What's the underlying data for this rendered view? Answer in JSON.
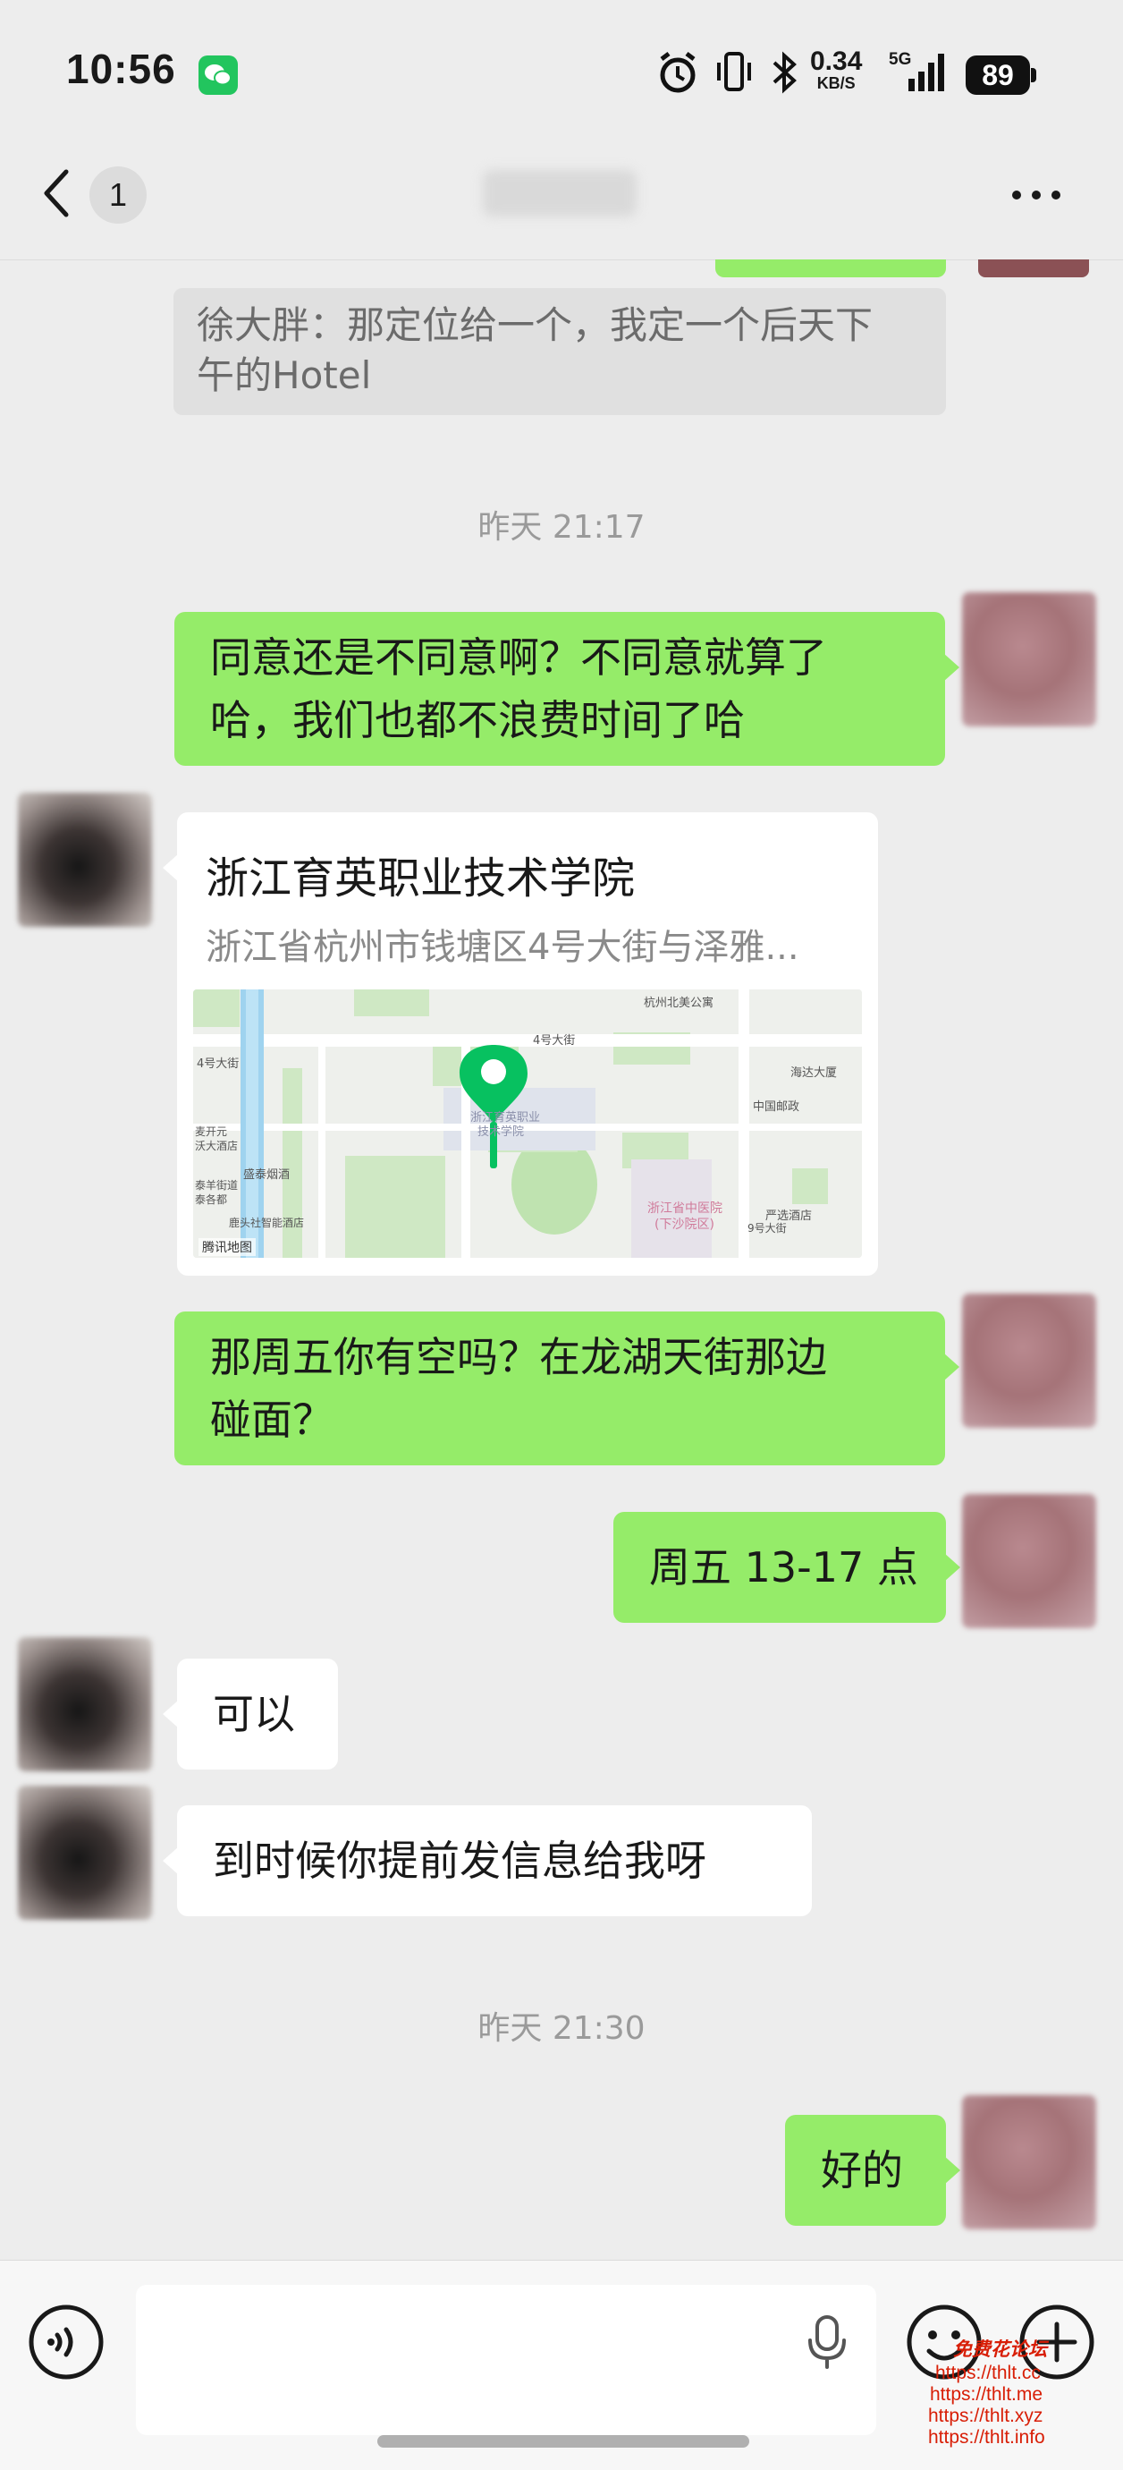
{
  "status_bar": {
    "time": "10:56",
    "net_speed_value": "0.34",
    "net_speed_unit": "KB/S",
    "network_type": "5G",
    "battery": "89",
    "icons": [
      "wechat-icon",
      "alarm-icon",
      "vibrate-icon",
      "bluetooth-icon",
      "signal-icon",
      "battery-icon"
    ]
  },
  "nav": {
    "unread_count": "1",
    "icons": [
      "back-arrow-icon",
      "more-icon"
    ]
  },
  "quote": {
    "text_line1": "徐大胖：那定位给一个，我定一个后天下",
    "text_line2": "午的Hotel"
  },
  "timestamps": [
    "昨天 21:17",
    "昨天 21:30"
  ],
  "messages": [
    {
      "side": "me",
      "lines": [
        "同意还是不同意啊？不同意就算了",
        "哈，我们也都不浪费时间了哈"
      ]
    },
    {
      "side": "them",
      "type": "location",
      "title": "浙江育英职业技术学院",
      "address": "浙江省杭州市钱塘区4号大街与泽雅..."
    },
    {
      "side": "me",
      "lines": [
        "那周五你有空吗？在龙湖天街那边",
        "碰面？"
      ]
    },
    {
      "side": "me",
      "lines": [
        "周五 13-17 点"
      ]
    },
    {
      "side": "them",
      "lines": [
        "可以"
      ]
    },
    {
      "side": "them",
      "lines": [
        "到时候你提前发信息给我呀"
      ]
    },
    {
      "side": "me",
      "lines": [
        "好的"
      ]
    }
  ],
  "map": {
    "labels": [
      "杭州北美公寓",
      "4号大街",
      "4号大街",
      "海达大厦",
      "中国邮政",
      "浙江育英职业",
      "技术学院",
      "浙江省中医院",
      "(下沙院区)",
      "严选酒店",
      "9号大街",
      "盛泰烟酒",
      "麦开元",
      "沃大酒店",
      "泰羊街道",
      "泰各都",
      "鹿头社智能酒店",
      "腾讯地图"
    ],
    "pin_color": "#07c160"
  },
  "input_bar": {
    "icons": [
      "voice-icon",
      "microphone-icon",
      "emoji-icon",
      "plus-icon"
    ]
  },
  "watermark": {
    "title": "免费花论坛",
    "urls": [
      "https://thlt.cc",
      "https://thlt.me",
      "https://thlt.xyz",
      "https://thlt.info"
    ]
  },
  "colors": {
    "bubble_green": "#95ec69",
    "bubble_white": "#ffffff",
    "background": "#ededed",
    "wechat_green": "#07c160"
  }
}
